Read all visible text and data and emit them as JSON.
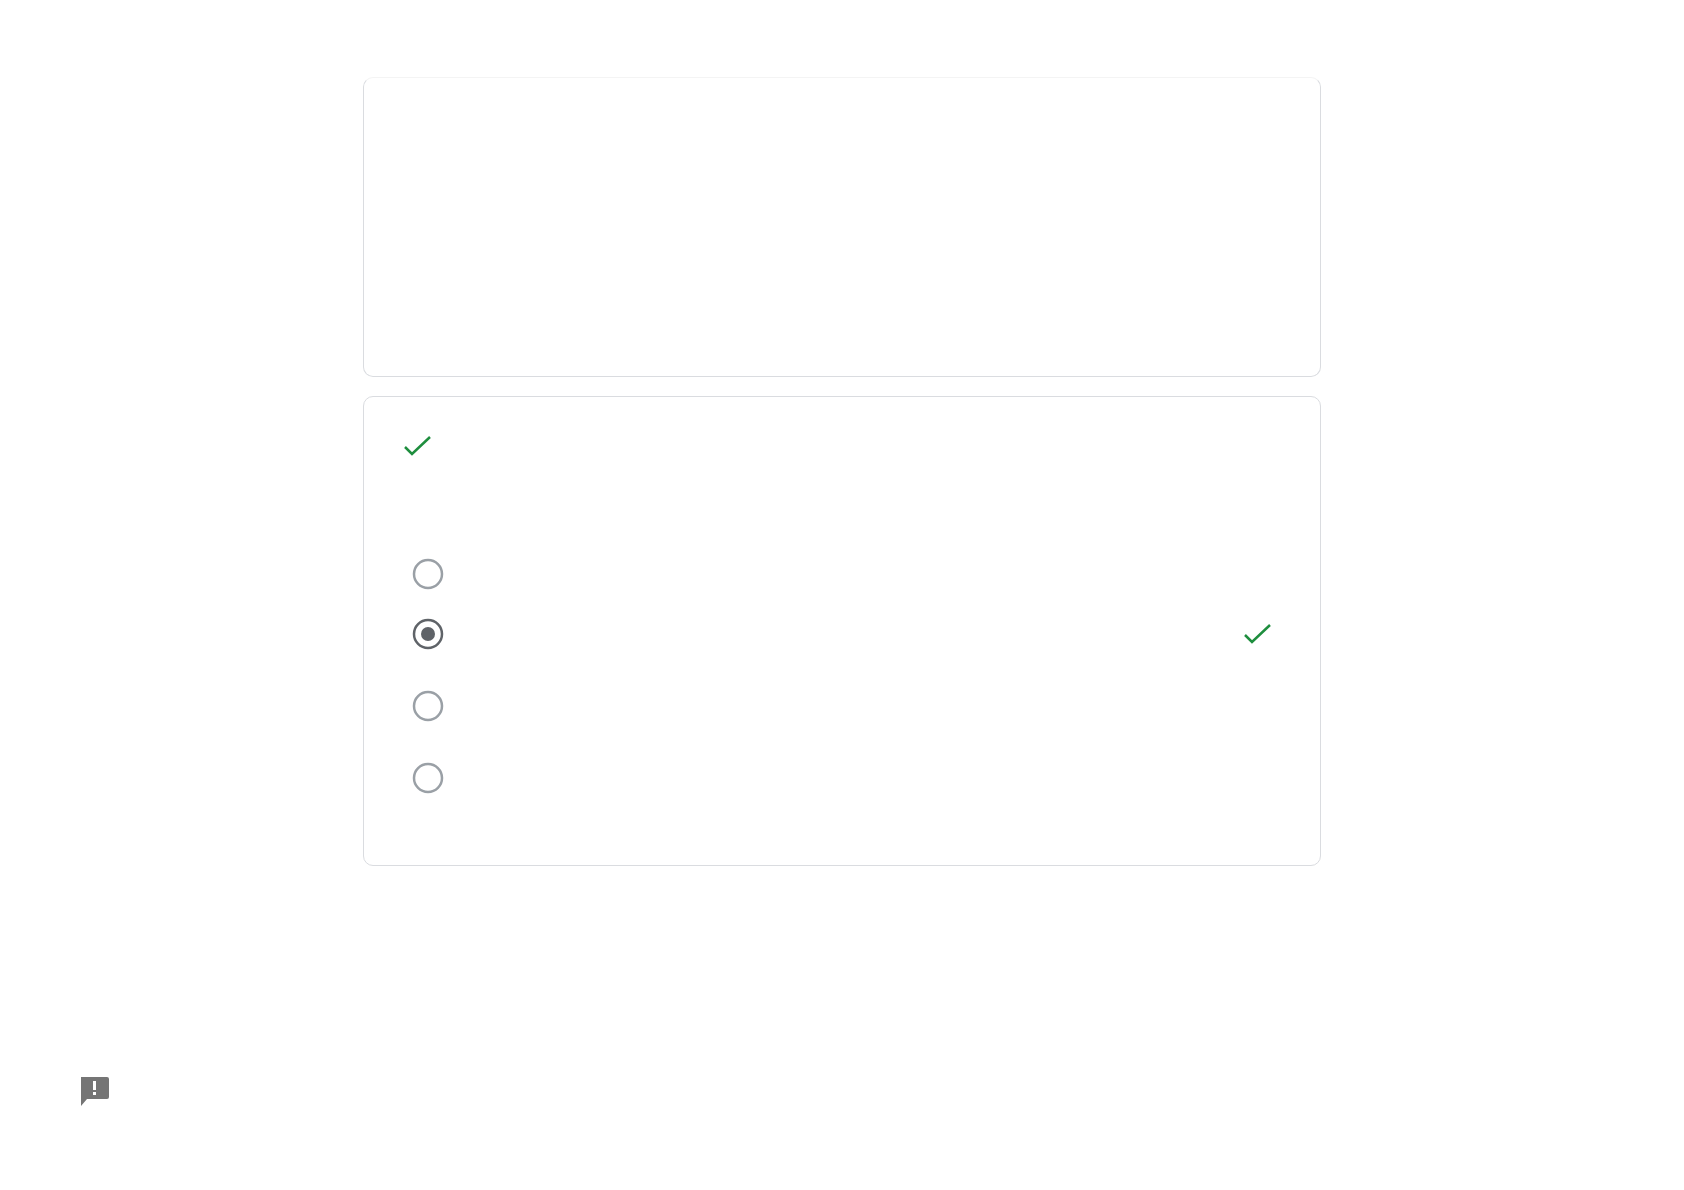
{
  "question": {
    "correct": true,
    "options": [
      {
        "selected": false,
        "correct": false
      },
      {
        "selected": true,
        "correct": true
      },
      {
        "selected": false,
        "correct": false
      },
      {
        "selected": false,
        "correct": false
      }
    ]
  }
}
